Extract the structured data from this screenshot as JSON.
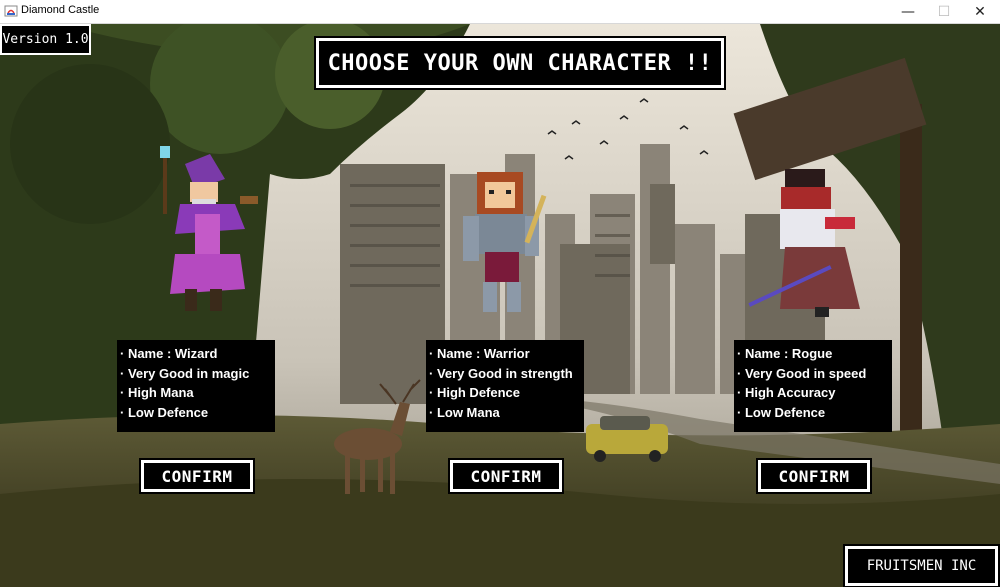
{
  "window": {
    "title": "Diamond Castle",
    "controls": {
      "minimize": "—",
      "maximize": "☐",
      "close": "✕"
    }
  },
  "hud": {
    "version": "Version 1.0",
    "heading": "CHOOSE YOUR OWN CHARACTER !!",
    "company": "FRUITSMEN INC"
  },
  "characters": [
    {
      "lines": [
        "· Name : Wizard",
        "· Very Good in magic",
        "· High Mana",
        "· Low Defence"
      ],
      "confirm_label": "CONFIRM",
      "sprite": "wizard-sprite"
    },
    {
      "lines": [
        "· Name : Warrior",
        "· Very Good in strength",
        "· High Defence",
        "· Low Mana"
      ],
      "confirm_label": "CONFIRM",
      "sprite": "warrior-sprite"
    },
    {
      "lines": [
        "· Name : Rogue",
        "· Very Good in speed",
        "· High Accuracy",
        "· Low Defence"
      ],
      "confirm_label": "CONFIRM",
      "sprite": "rogue-sprite"
    }
  ],
  "colors": {
    "panel": "#000000",
    "panel_text": "#ffffff",
    "sky": "#d9d2c6",
    "foliage": "#2f3a1c"
  }
}
